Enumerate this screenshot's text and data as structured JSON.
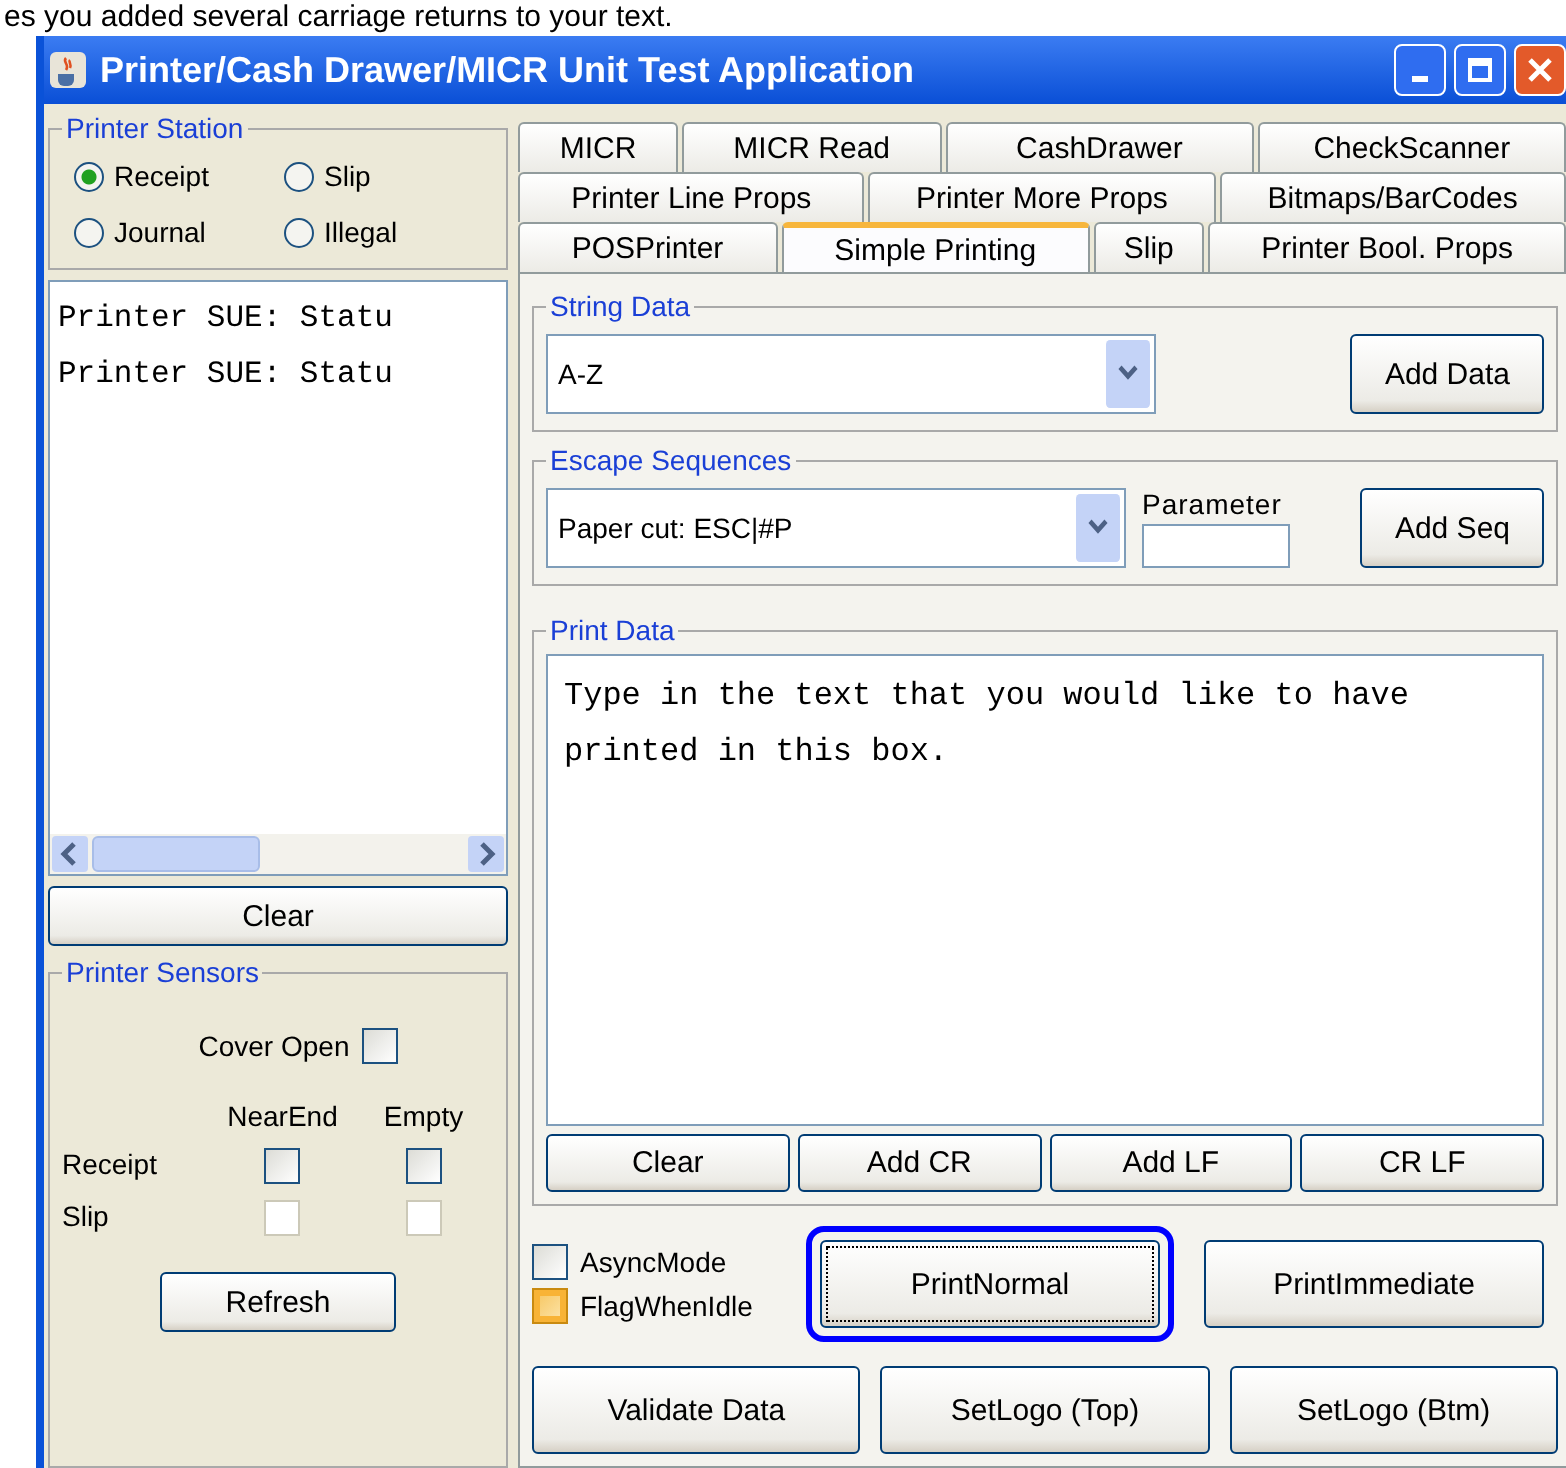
{
  "caption": "es you added several carriage returns to your text.",
  "window": {
    "title": "Printer/Cash Drawer/MICR Unit Test Application"
  },
  "printer_station": {
    "title": "Printer Station",
    "options": [
      {
        "label": "Receipt",
        "selected": true
      },
      {
        "label": "Slip",
        "selected": false
      },
      {
        "label": "Journal",
        "selected": false
      },
      {
        "label": "Illegal",
        "selected": false
      }
    ]
  },
  "log": {
    "lines": [
      "Printer SUE: Statu",
      "Printer SUE: Statu"
    ],
    "clear_button": "Clear"
  },
  "sensors": {
    "title": "Printer Sensors",
    "cover_open": {
      "label": "Cover Open",
      "checked": false
    },
    "columns": [
      "NearEnd",
      "Empty"
    ],
    "rows": [
      {
        "label": "Receipt",
        "checks": [
          {
            "checked": false,
            "disabled": false
          },
          {
            "checked": false,
            "disabled": false
          }
        ]
      },
      {
        "label": "Slip",
        "checks": [
          {
            "checked": false,
            "disabled": true
          },
          {
            "checked": false,
            "disabled": true
          }
        ]
      }
    ],
    "refresh_button": "Refresh"
  },
  "tabs": [
    [
      {
        "label": "MICR",
        "selected": false
      },
      {
        "label": "MICR Read",
        "selected": false
      },
      {
        "label": "CashDrawer",
        "selected": false
      },
      {
        "label": "CheckScanner",
        "selected": false
      }
    ],
    [
      {
        "label": "Printer Line Props",
        "selected": false
      },
      {
        "label": "Printer More Props",
        "selected": false
      },
      {
        "label": "Bitmaps/BarCodes",
        "selected": false
      }
    ],
    [
      {
        "label": "POSPrinter",
        "selected": false
      },
      {
        "label": "Simple Printing",
        "selected": true
      },
      {
        "label": "Slip",
        "selected": false
      },
      {
        "label": "Printer Bool. Props",
        "selected": false
      }
    ]
  ],
  "string_data": {
    "title": "String Data",
    "value": "A-Z",
    "button": "Add Data"
  },
  "escape_sequences": {
    "title": "Escape Sequences",
    "value": "Paper cut: ESC|#P",
    "parameter_label": "Parameter",
    "button": "Add Seq"
  },
  "print_data": {
    "title": "Print Data",
    "text": "Type in the text that you would like to have printed in this box.",
    "buttons": [
      "Clear",
      "Add CR",
      "Add LF",
      "CR LF"
    ]
  },
  "options": [
    {
      "label": "AsyncMode",
      "checked": false,
      "focused": false
    },
    {
      "label": "FlagWhenIdle",
      "checked": false,
      "focused": true
    }
  ],
  "actions": [
    {
      "label": "PrintNormal",
      "highlighted": true
    },
    {
      "label": "PrintImmediate",
      "highlighted": false
    }
  ],
  "bottom_buttons": [
    "Validate Data",
    "SetLogo (Top)",
    "SetLogo (Btm)"
  ]
}
